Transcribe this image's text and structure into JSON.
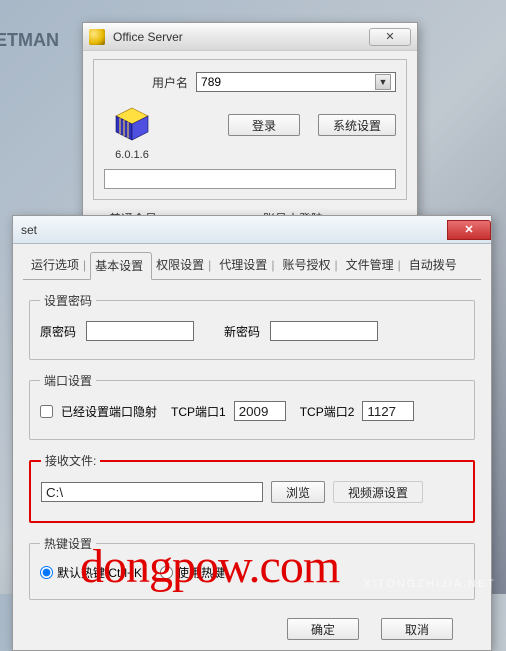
{
  "background": {
    "text": "NG NETMAN"
  },
  "office": {
    "title": "Office Server",
    "close_glyph": "✕",
    "username_label": "用户名",
    "username_value": "789",
    "login_btn": "登录",
    "settings_btn": "系统设置",
    "version": "6.0.1.6",
    "status_left": "普通会员",
    "status_right": "账号未登陆"
  },
  "set": {
    "title": "set",
    "close_glyph": "✕",
    "tabs": [
      "运行选项",
      "基本设置",
      "权限设置",
      "代理设置",
      "账号授权",
      "文件管理",
      "自动拨号"
    ],
    "active_tab_index": 1,
    "password": {
      "legend": "设置密码",
      "old_label": "原密码",
      "old_value": "",
      "new_label": "新密码",
      "new_value": ""
    },
    "port": {
      "legend": "端口设置",
      "nat_checked": false,
      "nat_label": "已经设置端口隐射",
      "tcp1_label": "TCP端口1",
      "tcp1_value": "2009",
      "tcp2_label": "TCP端口2",
      "tcp2_value": "1127"
    },
    "recv": {
      "legend": "接收文件:",
      "path_value": "C:\\",
      "browse_btn": "浏览",
      "video_btn": "视频源设置"
    },
    "hotkey": {
      "legend": "热键设置",
      "default_label": "默认热键 Ctrl+K",
      "custom_label": "使用热键",
      "selected": "default"
    },
    "ok_btn": "确定",
    "cancel_btn": "取消"
  },
  "watermark": "dongpow.com",
  "sub_watermark": "XITONGZHIJIA.NET"
}
